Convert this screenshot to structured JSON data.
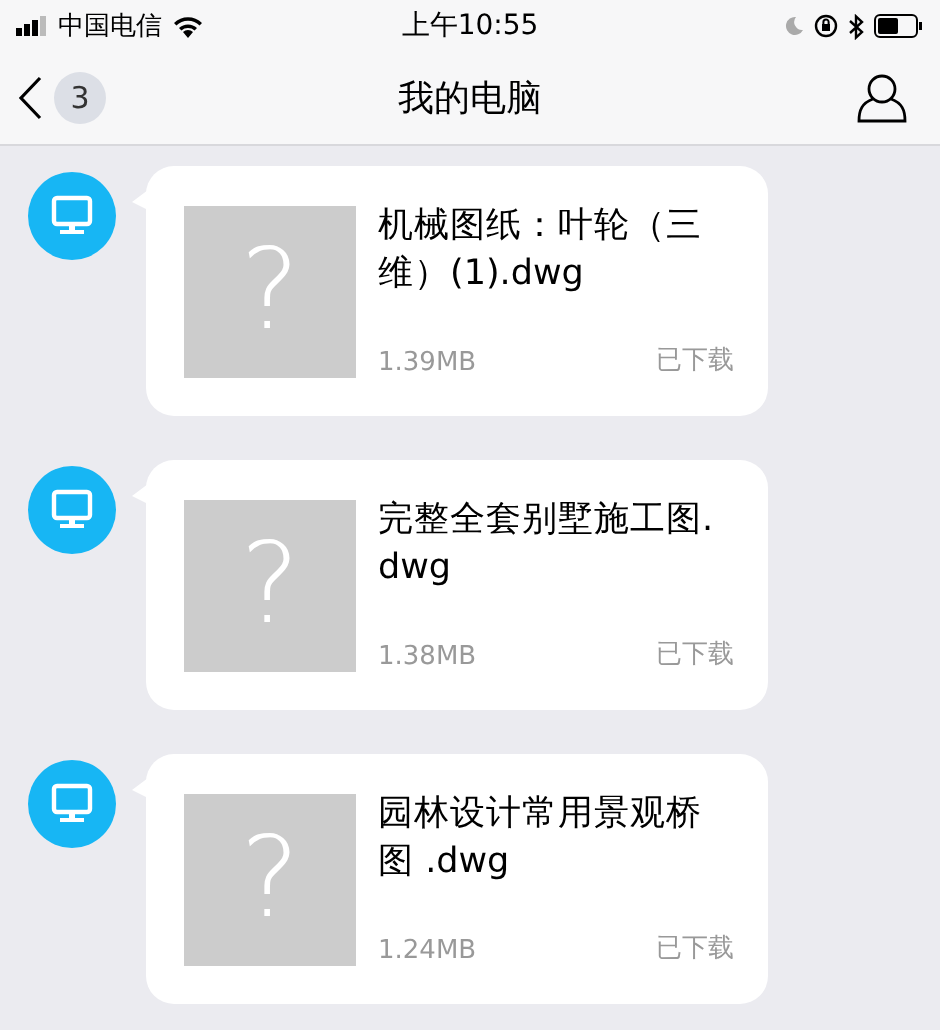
{
  "status_bar": {
    "carrier": "中国电信",
    "time": "上午10:55"
  },
  "nav": {
    "badge": "3",
    "title": "我的电脑"
  },
  "messages": [
    {
      "file_name": "机械图纸：叶轮（三维）(1).dwg",
      "thumbnail_glyph": "?",
      "size": "1.39MB",
      "status": "已下载"
    },
    {
      "file_name": "完整全套别墅施工图.dwg",
      "thumbnail_glyph": "?",
      "size": "1.38MB",
      "status": "已下载"
    },
    {
      "file_name": "园林设计常用景观桥图 .dwg",
      "thumbnail_glyph": "?",
      "size": "1.24MB",
      "status": "已下载"
    }
  ]
}
